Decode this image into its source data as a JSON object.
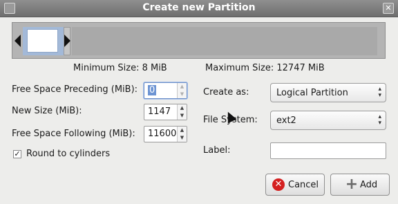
{
  "window": {
    "title": "Create new Partition",
    "close_glyph": "✕"
  },
  "visual": {
    "partition_fill_color": "#a3b9d8",
    "unallocated_color": "#a9a9a9",
    "left_handle_icon": "triangle-left-icon",
    "right_handle_icon": "triangle-right-icon"
  },
  "sizes": {
    "minimum": "Minimum Size: 8 MiB",
    "maximum": "Maximum Size: 12747 MiB"
  },
  "fields": {
    "free_preceding": {
      "label": "Free Space Preceding (MiB):",
      "value": "0"
    },
    "new_size": {
      "label": "New Size (MiB):",
      "value": "1147"
    },
    "free_following": {
      "label": "Free Space Following (MiB):",
      "value": "11600"
    },
    "round": {
      "label": "Round to cylinders",
      "checked_glyph": "✓"
    },
    "spin_arrows": {
      "up": "▲",
      "down": "▼"
    }
  },
  "options": {
    "create_as": {
      "label": "Create as:",
      "value": "Logical Partition"
    },
    "file_system": {
      "label": "File System:",
      "value": "ext2"
    },
    "partition_label": {
      "label": "Label:",
      "value": ""
    },
    "combo_chevron": "▴\n▾"
  },
  "buttons": {
    "cancel": {
      "label": "Cancel",
      "icon": "cancel-icon",
      "icon_glyph": "✕"
    },
    "add": {
      "label": "Add",
      "icon": "plus-icon",
      "icon_glyph": "+"
    }
  }
}
